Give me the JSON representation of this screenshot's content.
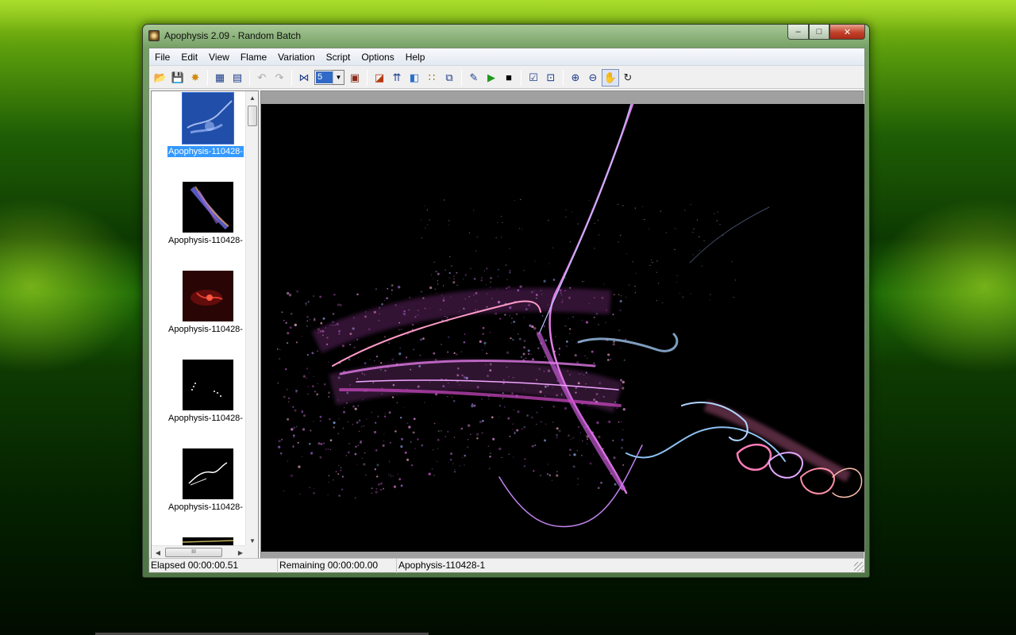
{
  "window": {
    "title": "Apophysis 2.09 - Random Batch",
    "minimize_glyph": "–",
    "maximize_glyph": "□",
    "close_glyph": "✕"
  },
  "menu": [
    "File",
    "Edit",
    "View",
    "Flame",
    "Variation",
    "Script",
    "Options",
    "Help"
  ],
  "toolbar": {
    "open_icon": "📂",
    "save_icon": "💾",
    "random_batch_icon": "✸",
    "list_view_icon": "▦",
    "list_detail_icon": "▤",
    "undo_icon": "↶",
    "redo_icon": "↷",
    "mutate_icon": "⋈",
    "quality_value": "5",
    "combo_arrow": "▼",
    "fullscreen_icon": "▣",
    "editor_icon": "◪",
    "adjust_icon": "⇈",
    "gradient_icon": "◧",
    "mutation_grid_icon": "∷",
    "render_window_icon": "⧉",
    "edit_script_icon": "✎",
    "run_script_icon": "▶",
    "stop_script_icon": "■",
    "options_icon": "☑",
    "transform_icon": "⊡",
    "zoom_in_icon": "⊕",
    "zoom_out_icon": "⊖",
    "pan_icon": "✋",
    "rotate_icon": "↻"
  },
  "thumbnails": [
    {
      "label": "Apophysis-110428-",
      "selected": true
    },
    {
      "label": "Apophysis-110428-",
      "selected": false
    },
    {
      "label": "Apophysis-110428-",
      "selected": false
    },
    {
      "label": "Apophysis-110428-",
      "selected": false
    },
    {
      "label": "Apophysis-110428-",
      "selected": false
    }
  ],
  "scroll": {
    "up": "▲",
    "down": "▼",
    "left": "◀",
    "right": "▶",
    "grip": "III"
  },
  "status": {
    "elapsed": "Elapsed 00:00:00.51",
    "remaining": "Remaining 00:00:00.00",
    "flame_name": "Apophysis-110428-1"
  },
  "colors": {
    "selection": "#3399ff",
    "flame_primary": "#d05ad6",
    "flame_secondary": "#7fb5e8",
    "flame_accent": "#ff7db8"
  }
}
